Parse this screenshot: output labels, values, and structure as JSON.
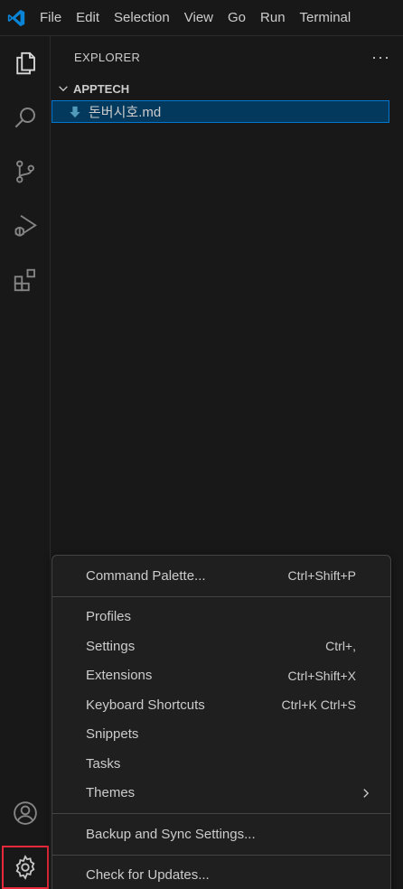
{
  "titlebar": {
    "logo_icon": "vscode-logo-icon",
    "menus": [
      "File",
      "Edit",
      "Selection",
      "View",
      "Go",
      "Run",
      "Terminal"
    ]
  },
  "activitybar": {
    "items": [
      "explorer-icon",
      "search-icon",
      "source-control-icon",
      "run-debug-icon",
      "extensions-icon"
    ],
    "bottom": [
      "accounts-icon",
      "manage-gear-icon"
    ],
    "accent": "#e8293b"
  },
  "sidebar": {
    "title": "EXPLORER",
    "more": "···",
    "folder": "APPTECH",
    "file": "돈버시호.md"
  },
  "menu": {
    "groups": [
      [
        {
          "label": "Command Palette...",
          "key": "Ctrl+Shift+P"
        }
      ],
      [
        {
          "label": "Profiles",
          "key": ""
        },
        {
          "label": "Settings",
          "key": "Ctrl+,"
        },
        {
          "label": "Extensions",
          "key": "Ctrl+Shift+X"
        },
        {
          "label": "Keyboard Shortcuts",
          "key": "Ctrl+K Ctrl+S"
        },
        {
          "label": "Snippets",
          "key": ""
        },
        {
          "label": "Tasks",
          "key": ""
        },
        {
          "label": "Themes",
          "key": ""
        }
      ],
      [
        {
          "label": "Backup and Sync Settings...",
          "key": ""
        }
      ],
      [
        {
          "label": "Check for Updates...",
          "key": ""
        }
      ]
    ]
  }
}
